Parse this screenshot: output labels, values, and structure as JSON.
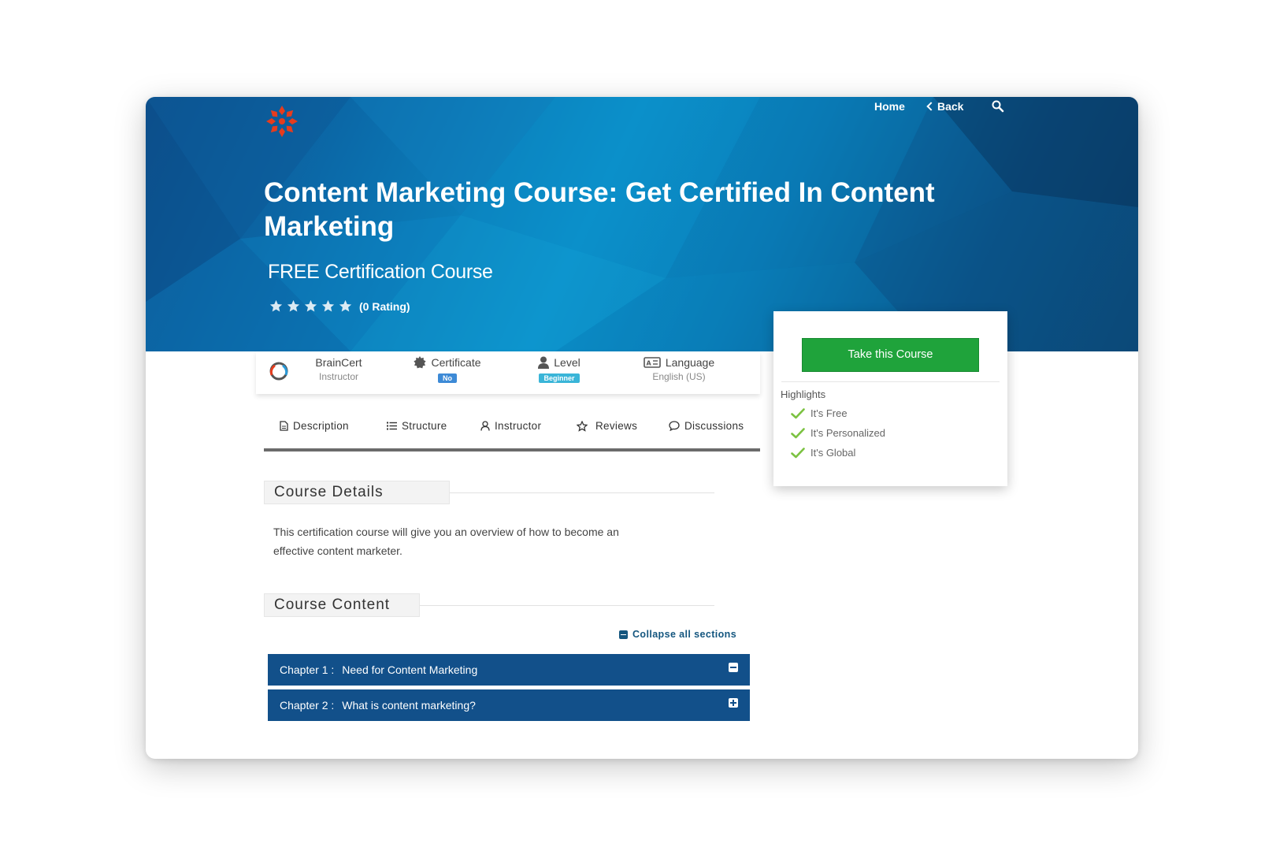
{
  "nav": {
    "home": "Home",
    "back": "Back"
  },
  "hero": {
    "title": "Content Marketing Course: Get Certified In Content Marketing",
    "subtitle": "FREE Certification Course",
    "rating_text": "(0 Rating)",
    "star_count": 5
  },
  "info": {
    "instructor_name": "BrainCert",
    "instructor_role": "Instructor",
    "certificate_label": "Certificate",
    "certificate_value": "No",
    "level_label": "Level",
    "level_value": "Beginner",
    "language_label": "Language",
    "language_value": "English (US)"
  },
  "tabs": [
    {
      "label": "Description",
      "icon": "document-icon"
    },
    {
      "label": "Structure",
      "icon": "list-icon"
    },
    {
      "label": "Instructor",
      "icon": "user-icon"
    },
    {
      "label": "Reviews",
      "icon": "star-outline-icon"
    },
    {
      "label": "Discussions",
      "icon": "chat-bubble-icon"
    }
  ],
  "course_details": {
    "heading": "Course Details",
    "text": "This certification course will give you an overview of how to become an effective content marketer."
  },
  "course_content": {
    "heading": "Course Content",
    "collapse_label": "Collapse all sections",
    "chapters": [
      {
        "number": "Chapter 1 :",
        "title": "Need for Content Marketing",
        "expanded": true
      },
      {
        "number": "Chapter 2 :",
        "title": "What is content marketing?",
        "expanded": false
      }
    ]
  },
  "card": {
    "button_label": "Take this Course",
    "highlights_title": "Highlights",
    "highlights": [
      "It's Free",
      "It's Personalized",
      "It's Global"
    ]
  },
  "colors": {
    "hero_blue": "#0b6aa9",
    "logo_red": "#e63c1e",
    "chapter_bg": "#12508a",
    "button_green": "#1fa33b",
    "check_green": "#7cc242"
  }
}
